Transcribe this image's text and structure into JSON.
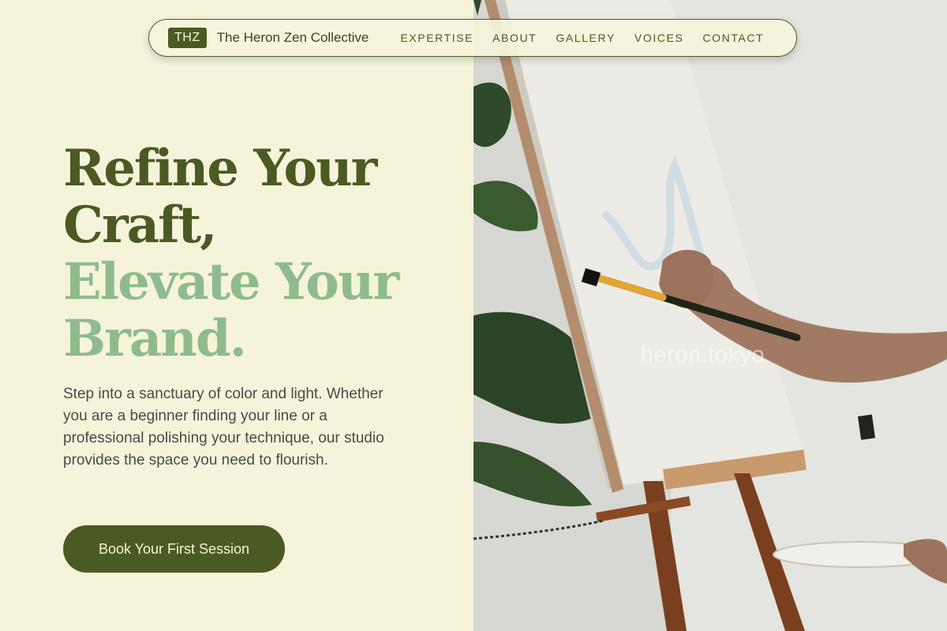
{
  "nav": {
    "logo_badge": "THZ",
    "brand_name": "The Heron Zen Collective",
    "links": [
      "EXPERTISE",
      "ABOUT",
      "GALLERY",
      "VOICES",
      "CONTACT"
    ]
  },
  "hero": {
    "headline_dark_1": "Refine Your",
    "headline_dark_2": "Craft,",
    "headline_light_1": "Elevate Your",
    "headline_light_2": "Brand.",
    "description": "Step into a sanctuary of color and light. Whether you are a beginner finding your line or a professional polishing your technique, our studio provides the space you need to flourish.",
    "cta_label": "Book Your First Session"
  },
  "image": {
    "subject": "painting-at-easel-photo",
    "watermark": "heron.tokyo"
  },
  "colors": {
    "background": "#f5f4db",
    "primary_dark_green": "#4b5a22",
    "accent_light_green": "#8fbb8c",
    "body_text": "#4a4a44"
  }
}
